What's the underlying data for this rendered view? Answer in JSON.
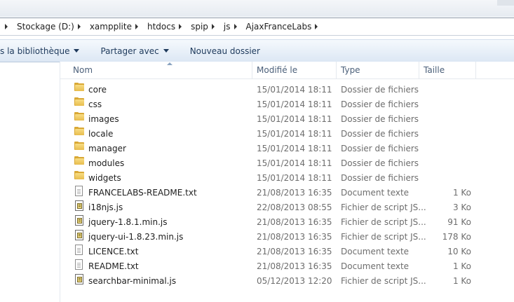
{
  "breadcrumb": {
    "items": [
      "Stockage (D:)",
      "xampplite",
      "htdocs",
      "spip",
      "js",
      "AjaxFranceLabs"
    ]
  },
  "toolbar": {
    "library_label": "s la bibliothèque",
    "share_label": "Partager avec",
    "new_folder_label": "Nouveau dossier"
  },
  "columns": {
    "name": "Nom",
    "modified": "Modifié le",
    "type": "Type",
    "size": "Taille"
  },
  "files": [
    {
      "icon": "folder-icon",
      "name": "core",
      "modified": "15/01/2014 18:11",
      "type": "Dossier de fichiers",
      "size": ""
    },
    {
      "icon": "folder-icon",
      "name": "css",
      "modified": "15/01/2014 18:11",
      "type": "Dossier de fichiers",
      "size": ""
    },
    {
      "icon": "folder-icon",
      "name": "images",
      "modified": "15/01/2014 18:11",
      "type": "Dossier de fichiers",
      "size": ""
    },
    {
      "icon": "folder-icon",
      "name": "locale",
      "modified": "15/01/2014 18:11",
      "type": "Dossier de fichiers",
      "size": ""
    },
    {
      "icon": "folder-icon",
      "name": "manager",
      "modified": "15/01/2014 18:11",
      "type": "Dossier de fichiers",
      "size": ""
    },
    {
      "icon": "folder-icon",
      "name": "modules",
      "modified": "15/01/2014 18:11",
      "type": "Dossier de fichiers",
      "size": ""
    },
    {
      "icon": "folder-icon",
      "name": "widgets",
      "modified": "15/01/2014 18:11",
      "type": "Dossier de fichiers",
      "size": ""
    },
    {
      "icon": "text-file-icon",
      "name": "FRANCELABS-README.txt",
      "modified": "21/08/2013 16:35",
      "type": "Document texte",
      "size": "1 Ko"
    },
    {
      "icon": "script-file-icon",
      "name": "i18njs.js",
      "modified": "22/08/2013 08:55",
      "type": "Fichier de script JS...",
      "size": "3 Ko"
    },
    {
      "icon": "script-file-icon",
      "name": "jquery-1.8.1.min.js",
      "modified": "21/08/2013 16:35",
      "type": "Fichier de script JS...",
      "size": "91 Ko"
    },
    {
      "icon": "script-file-icon",
      "name": "jquery-ui-1.8.23.min.js",
      "modified": "21/08/2013 16:35",
      "type": "Fichier de script JS...",
      "size": "178 Ko"
    },
    {
      "icon": "text-file-icon",
      "name": "LICENCE.txt",
      "modified": "21/08/2013 16:35",
      "type": "Document texte",
      "size": "10 Ko"
    },
    {
      "icon": "text-file-icon",
      "name": "README.txt",
      "modified": "21/08/2013 16:35",
      "type": "Document texte",
      "size": "1 Ko"
    },
    {
      "icon": "script-file-icon",
      "name": "searchbar-minimal.js",
      "modified": "05/12/2013 12:20",
      "type": "Fichier de script JS...",
      "size": "1 Ko"
    }
  ]
}
